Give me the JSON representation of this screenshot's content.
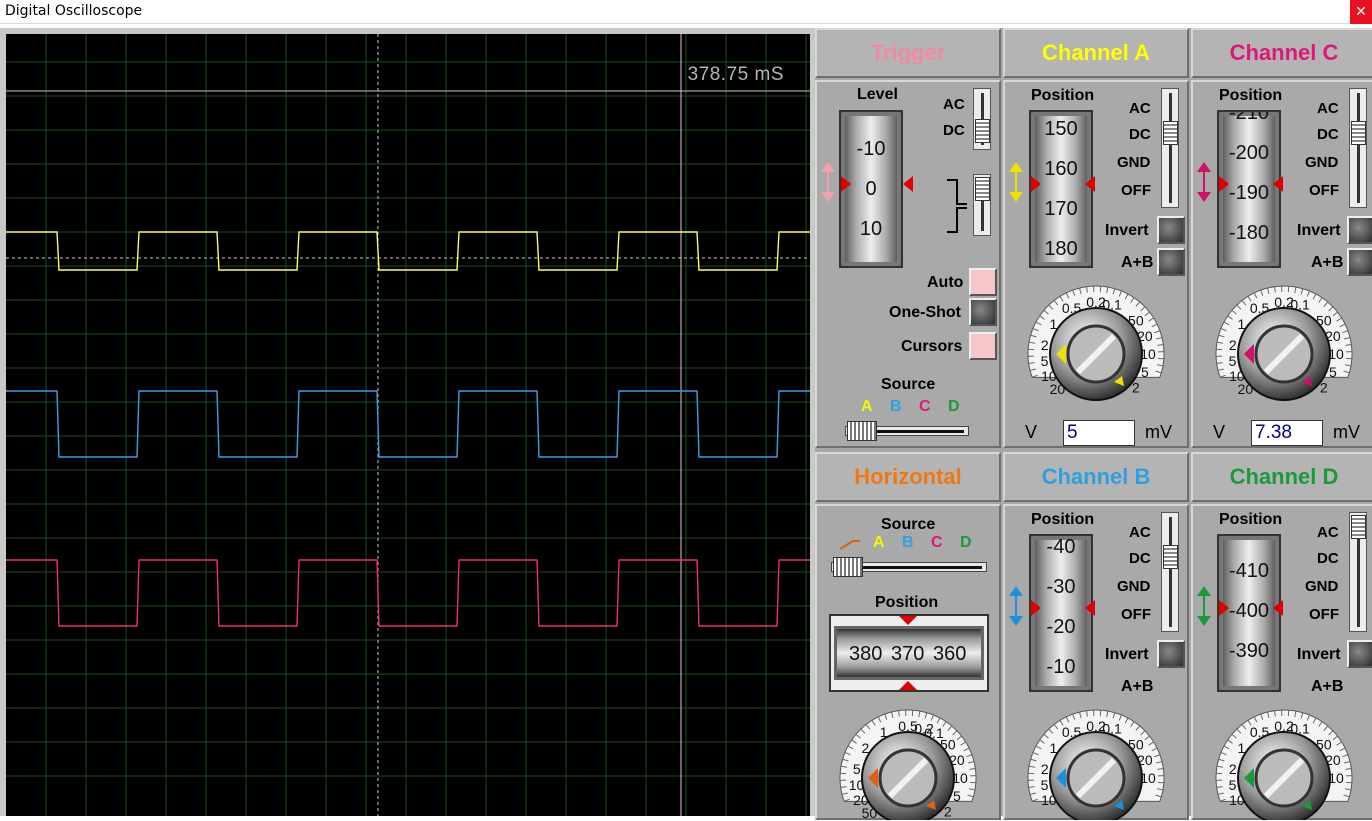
{
  "window": {
    "title": "Digital Oscilloscope",
    "close_glyph": "✕"
  },
  "screen": {
    "time_readout": "378.75 mS",
    "grid": {
      "cols": 16,
      "rows": 24
    },
    "trace_colors": {
      "A": "#ffff50",
      "B": "#3aa0e0",
      "C": "#e8306a"
    }
  },
  "trigger": {
    "title": "Trigger",
    "title_color": "#f08aa0",
    "level_label": "Level",
    "level_ticks": [
      "-10",
      "0",
      "10"
    ],
    "coupling": [
      "AC",
      "DC"
    ],
    "auto_label": "Auto",
    "oneshot_label": "One-Shot",
    "cursors_label": "Cursors",
    "source_label": "Source",
    "sources": [
      {
        "name": "A",
        "color": "#f5f500"
      },
      {
        "name": "B",
        "color": "#2ea0e0"
      },
      {
        "name": "C",
        "color": "#e0167a"
      },
      {
        "name": "D",
        "color": "#1a9a3a"
      }
    ]
  },
  "channel_a": {
    "title": "Channel A",
    "title_color": "#ffff00",
    "position_label": "Position",
    "position_ticks": [
      "150",
      "160",
      "170",
      "180"
    ],
    "coupling": [
      "AC",
      "DC",
      "GND",
      "OFF"
    ],
    "invert_label": "Invert",
    "sum_label": "A+B",
    "dial_left": [
      "0.5",
      "1",
      "2",
      "5",
      "10",
      "20"
    ],
    "dial_top": [
      "0.2",
      "0.1"
    ],
    "dial_right": [
      "50",
      "20",
      "10",
      "5",
      "2"
    ],
    "unit_left": "V",
    "unit_right": "mV",
    "value": "5",
    "arrow_color": "#f0e000"
  },
  "channel_c": {
    "title": "Channel C",
    "title_color": "#e0167a",
    "position_label": "Position",
    "position_ticks": [
      "-210",
      "-200",
      "-190",
      "-180"
    ],
    "coupling": [
      "AC",
      "DC",
      "GND",
      "OFF"
    ],
    "invert_label": "Invert",
    "sum_label": "A+B",
    "dial_left": [
      "0.5",
      "1",
      "2",
      "5",
      "10",
      "20"
    ],
    "dial_top": [
      "0.2",
      "0.1"
    ],
    "dial_right": [
      "50",
      "20",
      "10",
      "5",
      "2"
    ],
    "unit_left": "V",
    "unit_right": "mV",
    "value": "7.38",
    "arrow_color": "#d0106a"
  },
  "horizontal": {
    "title": "Horizontal",
    "title_color": "#f07810",
    "source_label": "Source",
    "sources": [
      {
        "name": "A",
        "color": "#f5f500"
      },
      {
        "name": "B",
        "color": "#2ea0e0"
      },
      {
        "name": "C",
        "color": "#e0167a"
      },
      {
        "name": "D",
        "color": "#1a9a3a"
      }
    ],
    "position_label": "Position",
    "position_ticks": [
      "380",
      "370",
      "360"
    ],
    "dial_left": [
      "1",
      "2",
      "5",
      "10",
      "20",
      "50"
    ],
    "dial_top": [
      "0.5",
      "0.2",
      "0.1"
    ],
    "dial_right": [
      "50",
      "20",
      "10",
      "5",
      "2"
    ],
    "arrow_color": "#e06010"
  },
  "channel_b": {
    "title": "Channel B",
    "title_color": "#2ea0e0",
    "position_label": "Position",
    "position_ticks": [
      "-40",
      "-30",
      "-20",
      "-10"
    ],
    "coupling": [
      "AC",
      "DC",
      "GND",
      "OFF"
    ],
    "invert_label": "Invert",
    "sum_label": "A+B",
    "dial_left": [
      "0.5",
      "1",
      "2",
      "5",
      "10"
    ],
    "dial_top": [
      "0.2",
      "0.1"
    ],
    "dial_right": [
      "50",
      "20",
      "10"
    ],
    "arrow_color": "#1a90e0"
  },
  "channel_d": {
    "title": "Channel D",
    "title_color": "#1a9a3a",
    "position_label": "Position",
    "position_ticks": [
      "-410",
      "-400",
      "-390"
    ],
    "coupling": [
      "AC",
      "DC",
      "GND",
      "OFF"
    ],
    "invert_label": "Invert",
    "sum_label": "A+B",
    "dial_left": [
      "0.5",
      "1",
      "2",
      "5",
      "10"
    ],
    "dial_top": [
      "0.2",
      "0.1"
    ],
    "dial_right": [
      "50",
      "20",
      "10"
    ],
    "arrow_color": "#1a9a3a"
  }
}
